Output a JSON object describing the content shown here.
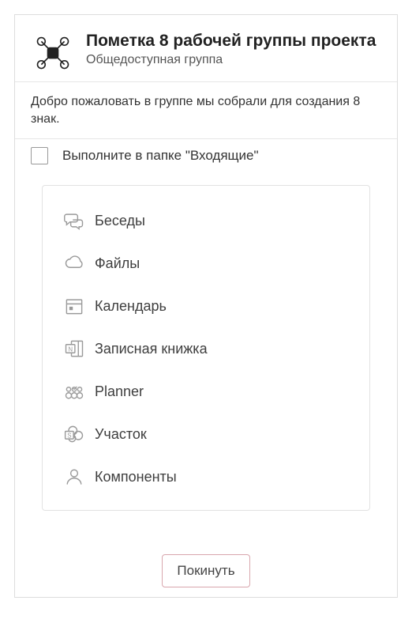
{
  "header": {
    "title": "Пометка 8 рабочей группы проекта",
    "subtitle": "Общедоступная группа"
  },
  "description": "Добро пожаловать в группе мы собрали для создания 8 знак.",
  "inbox": {
    "label": "Выполните в папке \"Входящие\"",
    "checked": false
  },
  "nav": {
    "items": [
      {
        "icon": "chat-bubbles-icon",
        "label": "Беседы"
      },
      {
        "icon": "cloud-icon",
        "label": "Файлы"
      },
      {
        "icon": "calendar-icon",
        "label": "Календарь"
      },
      {
        "icon": "notebook-icon",
        "label": "Записная книжка"
      },
      {
        "icon": "planner-icon",
        "label": "Planner"
      },
      {
        "icon": "sharepoint-icon",
        "label": "Участок"
      },
      {
        "icon": "person-icon",
        "label": "Компоненты"
      }
    ]
  },
  "footer": {
    "leave_label": "Покинуть"
  }
}
